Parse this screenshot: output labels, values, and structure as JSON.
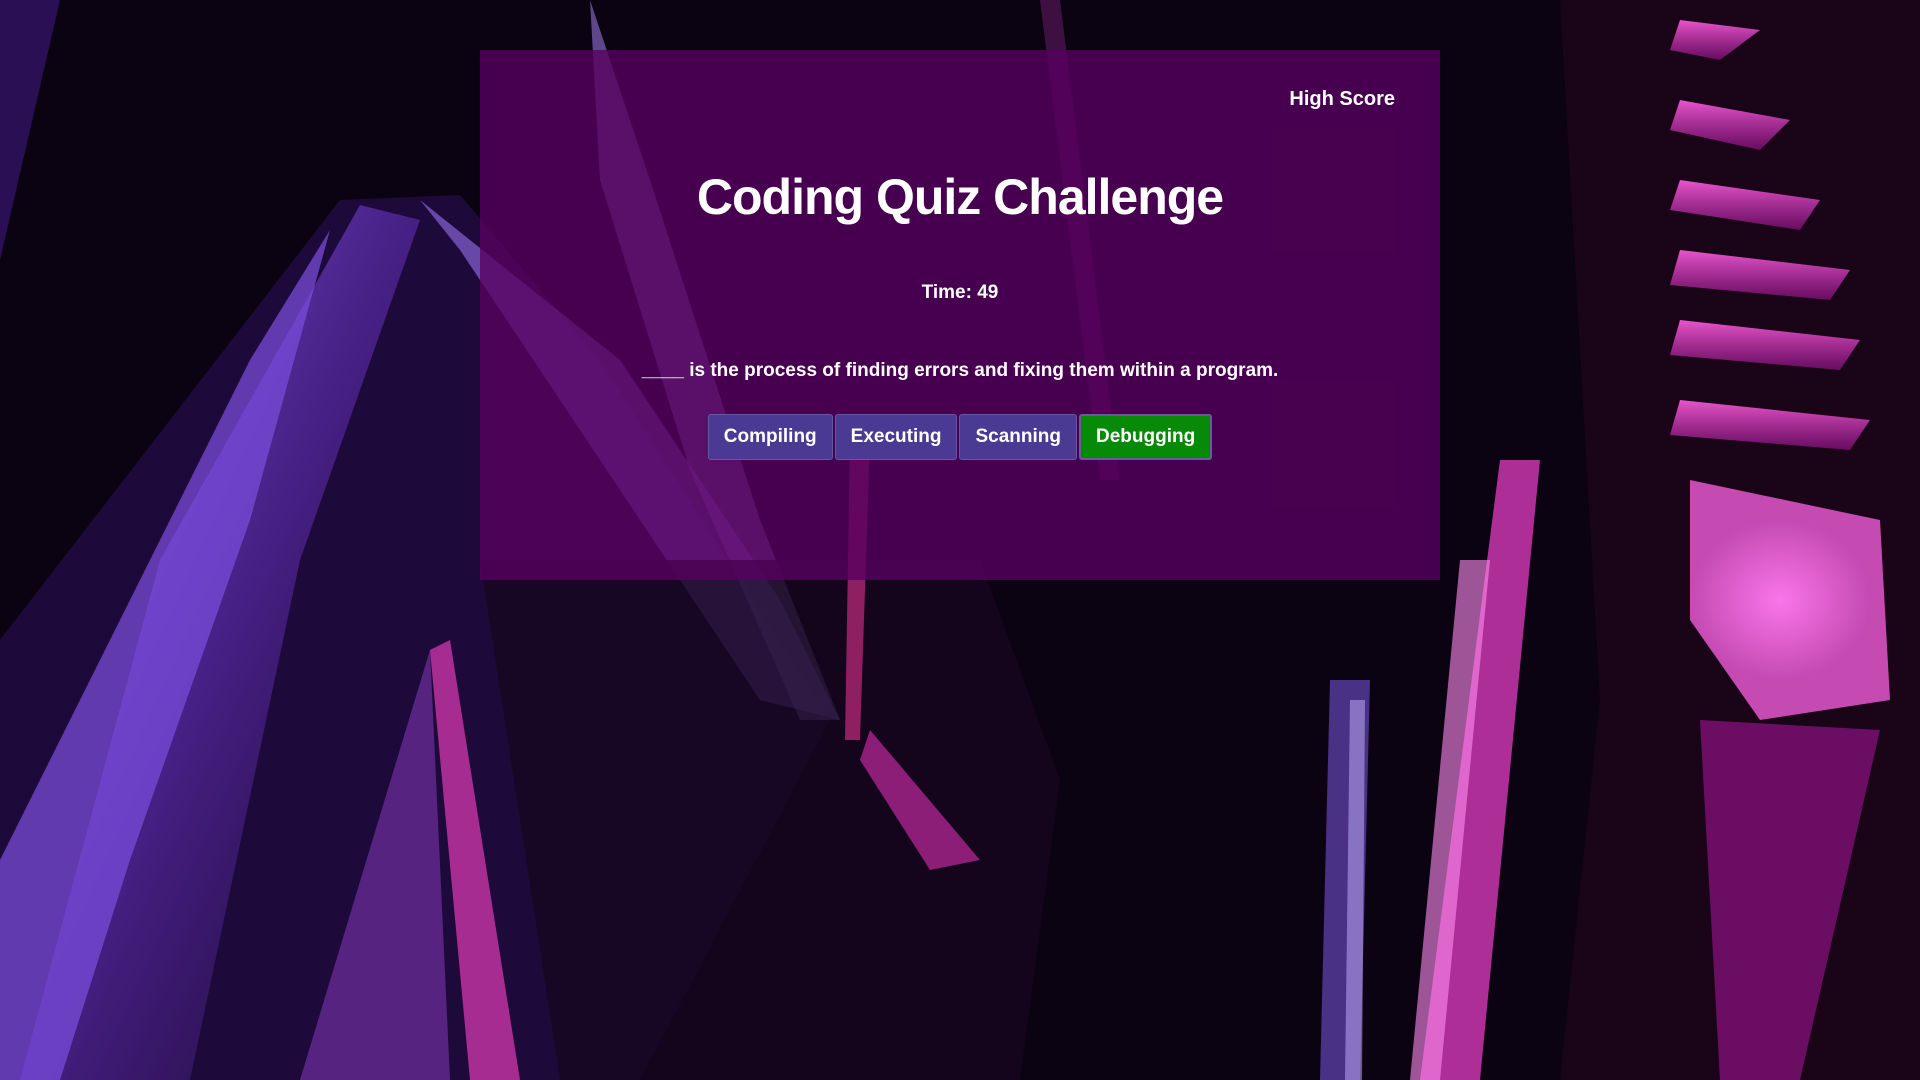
{
  "header": {
    "high_score_link": "High Score"
  },
  "quiz": {
    "title": "Coding Quiz Challenge",
    "timer_text": "Time: 49",
    "question": "____ is the process of finding errors and fixing them within a program.",
    "answers": [
      {
        "label": "Compiling"
      },
      {
        "label": "Executing"
      },
      {
        "label": "Scanning"
      },
      {
        "label": "Debugging",
        "state": "correct"
      }
    ]
  },
  "colors": {
    "card_background": "#580060",
    "answer_button": "#4b3a94",
    "correct_button": "#078a07",
    "text": "#ffffff",
    "background_dark": "#0a0310",
    "neon_purple": "#8f5cf0",
    "neon_pink": "#e040c8"
  }
}
